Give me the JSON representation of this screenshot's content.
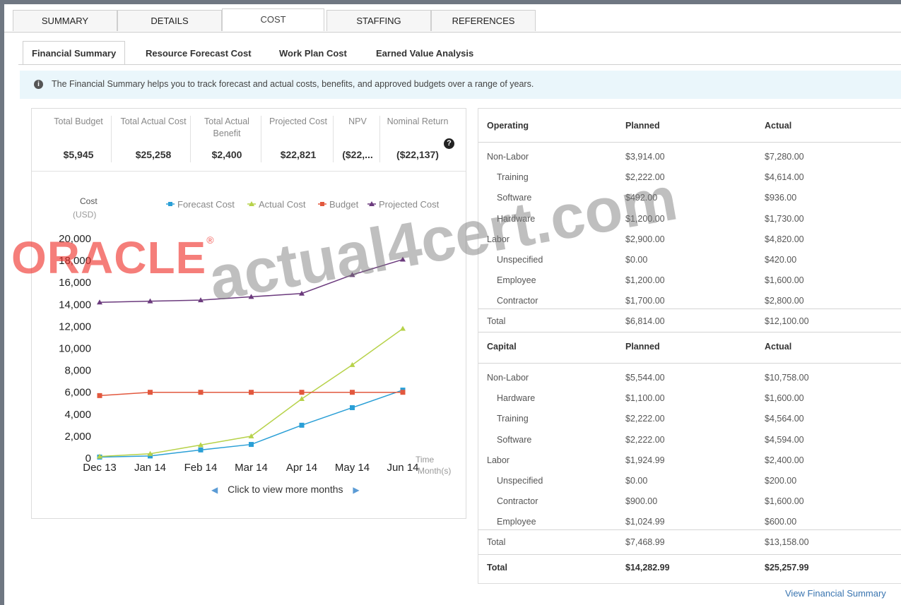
{
  "top_tabs": [
    "SUMMARY",
    "DETAILS",
    "COST",
    "STAFFING",
    "REFERENCES"
  ],
  "active_top_tab": "COST",
  "sub_tabs": [
    "Financial Summary",
    "Resource Forecast Cost",
    "Work Plan Cost",
    "Earned Value Analysis"
  ],
  "active_sub_tab": "Financial Summary",
  "info": {
    "icon": "info-icon",
    "text": "The Financial Summary helps you to track forecast and actual costs, benefits, and approved budgets over a range of years."
  },
  "kpis": [
    {
      "label": "Total Budget",
      "value": "$5,945"
    },
    {
      "label": "Total Actual Cost",
      "value": "$25,258"
    },
    {
      "label": "Total Actual Benefit",
      "value": "$2,400"
    },
    {
      "label": "Projected Cost",
      "value": "$22,821"
    },
    {
      "label": "NPV",
      "value": "($22,..."
    },
    {
      "label": "Nominal Return",
      "value": "($22,137)"
    }
  ],
  "help_icon": "question-icon",
  "chart_data": {
    "type": "line",
    "ylabel": "Cost (USD)",
    "xlabel": "Time Month(s)",
    "categories": [
      "Dec 13",
      "Jan 14",
      "Feb 14",
      "Mar 14",
      "Apr 14",
      "May 14",
      "Jun 14"
    ],
    "ylim": [
      0,
      20000
    ],
    "yticks": [
      "0",
      "2,000",
      "4,000",
      "6,000",
      "8,000",
      "10,000",
      "12,000",
      "14,000",
      "16,000",
      "18,000",
      "20,000"
    ],
    "legend_position": "top",
    "series": [
      {
        "name": "Forecast Cost",
        "color": "#2a9fd6",
        "values": [
          100,
          200,
          750,
          1250,
          3000,
          4600,
          6200
        ]
      },
      {
        "name": "Actual Cost",
        "color": "#b7d24a",
        "values": [
          150,
          400,
          1200,
          2000,
          5400,
          8500,
          11800
        ]
      },
      {
        "name": "Budget",
        "color": "#e2583e",
        "values": [
          5700,
          6000,
          6000,
          6000,
          6000,
          6000,
          6000
        ]
      },
      {
        "name": "Projected Cost",
        "color": "#6b3a7d",
        "values": [
          14200,
          14300,
          14400,
          14700,
          15000,
          16700,
          18100
        ]
      }
    ]
  },
  "chart_nav": {
    "text": "Click to view more months",
    "prev_icon": "chevron-left-icon",
    "next_icon": "chevron-right-icon"
  },
  "operating": {
    "header": [
      "Operating",
      "Planned",
      "Actual"
    ],
    "rows": [
      {
        "label": "Non-Labor",
        "planned": "$3,914.00",
        "actual": "$7,280.00",
        "indent": false
      },
      {
        "label": "Training",
        "planned": "$2,222.00",
        "actual": "$4,614.00",
        "indent": true
      },
      {
        "label": "Software",
        "planned": "$492.00",
        "actual": "$936.00",
        "indent": true
      },
      {
        "label": "Hardware",
        "planned": "$1,200.00",
        "actual": "$1,730.00",
        "indent": true
      },
      {
        "label": "Labor",
        "planned": "$2,900.00",
        "actual": "$4,820.00",
        "indent": false
      },
      {
        "label": "Unspecified",
        "planned": "$0.00",
        "actual": "$420.00",
        "indent": true
      },
      {
        "label": "Employee",
        "planned": "$1,200.00",
        "actual": "$1,600.00",
        "indent": true
      },
      {
        "label": "Contractor",
        "planned": "$1,700.00",
        "actual": "$2,800.00",
        "indent": true
      }
    ],
    "total": {
      "label": "Total",
      "planned": "$6,814.00",
      "actual": "$12,100.00"
    }
  },
  "capital": {
    "header": [
      "Capital",
      "Planned",
      "Actual"
    ],
    "rows": [
      {
        "label": "Non-Labor",
        "planned": "$5,544.00",
        "actual": "$10,758.00",
        "indent": false
      },
      {
        "label": "Hardware",
        "planned": "$1,100.00",
        "actual": "$1,600.00",
        "indent": true
      },
      {
        "label": "Training",
        "planned": "$2,222.00",
        "actual": "$4,564.00",
        "indent": true
      },
      {
        "label": "Software",
        "planned": "$2,222.00",
        "actual": "$4,594.00",
        "indent": true
      },
      {
        "label": "Labor",
        "planned": "$1,924.99",
        "actual": "$2,400.00",
        "indent": false
      },
      {
        "label": "Unspecified",
        "planned": "$0.00",
        "actual": "$200.00",
        "indent": true
      },
      {
        "label": "Contractor",
        "planned": "$900.00",
        "actual": "$1,600.00",
        "indent": true
      },
      {
        "label": "Employee",
        "planned": "$1,024.99",
        "actual": "$600.00",
        "indent": true
      }
    ],
    "total": {
      "label": "Total",
      "planned": "$7,468.99",
      "actual": "$13,158.00"
    }
  },
  "grand_total": {
    "label": "Total",
    "planned": "$14,282.99",
    "actual": "$25,257.99"
  },
  "view_link": "View Financial Summary",
  "watermarks": {
    "logo": "ORACLE",
    "site": "actual4cert.com"
  }
}
